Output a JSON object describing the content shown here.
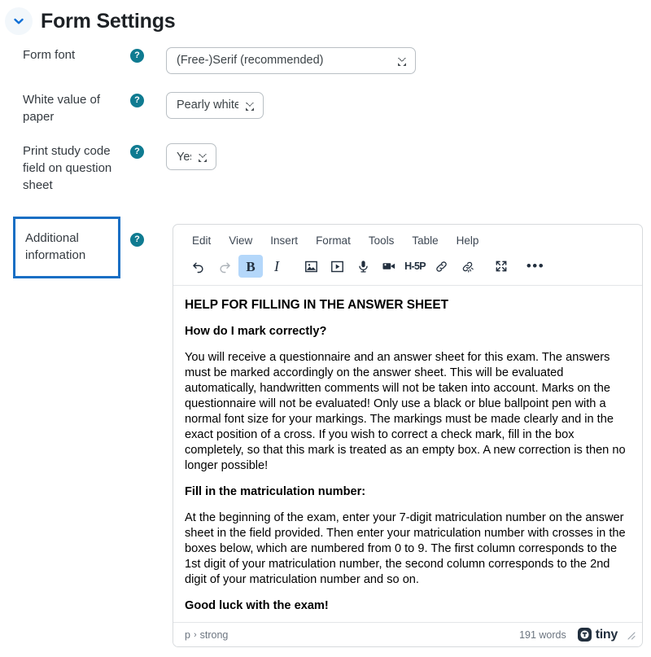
{
  "header": {
    "title": "Form Settings",
    "collapse_icon": "chevron-down-icon"
  },
  "fields": [
    {
      "label": "Form font",
      "help_icon": "help-icon",
      "control": "select",
      "value": "(Free-)Serif (recommended)"
    },
    {
      "label": "White value of paper",
      "help_icon": "help-icon",
      "control": "select",
      "value": "Pearly white"
    },
    {
      "label": "Print study code field on question sheet",
      "help_icon": "help-icon",
      "control": "select",
      "value": "Yes"
    },
    {
      "label": "Additional information",
      "help_icon": "help-icon",
      "control": "richtext",
      "focused": true
    }
  ],
  "editor": {
    "menubar": [
      "Edit",
      "View",
      "Insert",
      "Format",
      "Tools",
      "Table",
      "Help"
    ],
    "toolbar": [
      {
        "name": "undo-icon",
        "label": "Undo",
        "state": "enabled"
      },
      {
        "name": "redo-icon",
        "label": "Redo",
        "state": "disabled"
      },
      {
        "name": "bold-icon",
        "label": "B",
        "state": "active"
      },
      {
        "name": "italic-icon",
        "label": "I",
        "state": "enabled"
      },
      {
        "name": "image-icon",
        "label": "Insert image",
        "state": "enabled"
      },
      {
        "name": "media-icon",
        "label": "Insert media",
        "state": "enabled"
      },
      {
        "name": "microphone-icon",
        "label": "Record audio",
        "state": "enabled"
      },
      {
        "name": "video-camera-icon",
        "label": "Record video",
        "state": "enabled"
      },
      {
        "name": "h5p-icon",
        "label": "H-5P",
        "state": "enabled"
      },
      {
        "name": "link-icon",
        "label": "Insert link",
        "state": "enabled"
      },
      {
        "name": "unlink-icon",
        "label": "Remove link",
        "state": "enabled"
      },
      {
        "name": "fullscreen-icon",
        "label": "Fullscreen",
        "state": "enabled"
      },
      {
        "name": "more-icon",
        "label": "More",
        "state": "enabled"
      }
    ],
    "content": {
      "title": "HELP FOR FILLING IN THE ANSWER SHEET",
      "section1_heading": "How do I mark correctly?",
      "section1_body": "You will receive a questionnaire and an answer sheet for this exam. The answers must be marked accordingly on the answer sheet. This will be evaluated automatically, handwritten comments will not be taken into account. Marks on the questionnaire will not be evaluated! Only use a black or blue ballpoint pen with a normal font size for your markings. The markings must be made clearly and in the exact position of a cross. If you wish to correct a check mark, fill in the box completely, so that this mark is treated as an empty box. A new correction is then no longer possible!",
      "section2_heading": "Fill in the matriculation number:",
      "section2_body": "At the beginning of the exam, enter your 7-digit matriculation number on the answer sheet in the field provided. Then enter your matriculation number with crosses in the boxes below, which are numbered from 0 to 9. The first column corresponds to the 1st digit of your matriculation number, the second column corresponds to the 2nd digit of your matriculation number and so on.",
      "closing": "Good luck with the exam!"
    },
    "statusbar": {
      "path_root": "p",
      "path_separator": "›",
      "path_leaf": "strong",
      "word_count": "191 words",
      "brand": "tiny",
      "resize_handle": "resize-grip-icon"
    }
  },
  "colors": {
    "accent_blue": "#1a6fc4",
    "help_teal": "#0f7b91",
    "active_toolbar": "#b4d7fa",
    "text": "#212529",
    "muted": "#6c7580"
  }
}
